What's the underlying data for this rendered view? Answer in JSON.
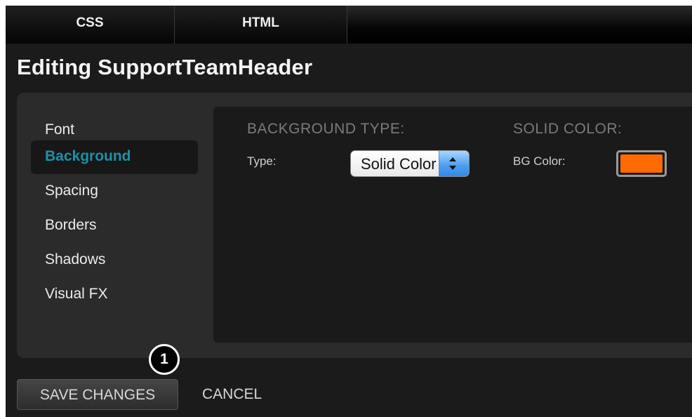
{
  "tabs": [
    {
      "label": "CSS"
    },
    {
      "label": "HTML"
    }
  ],
  "title": "Editing SupportTeamHeader",
  "sidebar": {
    "items": [
      {
        "label": "Font",
        "active": false
      },
      {
        "label": "Background",
        "active": true
      },
      {
        "label": "Spacing",
        "active": false
      },
      {
        "label": "Borders",
        "active": false
      },
      {
        "label": "Shadows",
        "active": false
      },
      {
        "label": "Visual FX",
        "active": false
      }
    ]
  },
  "background_type": {
    "heading": "BACKGROUND TYPE:",
    "type_label": "Type:",
    "type_value": "Solid Color"
  },
  "solid_color": {
    "heading": "SOLID COLOR:",
    "bg_label": "BG Color:",
    "bg_value": "#ff6b00"
  },
  "actions": {
    "save_label": "SAVE CHANGES",
    "cancel_label": "CANCEL"
  },
  "callout": {
    "number": "1"
  },
  "colors": {
    "accent_active": "#1f8fa6",
    "swatch": "#ff6b00"
  }
}
